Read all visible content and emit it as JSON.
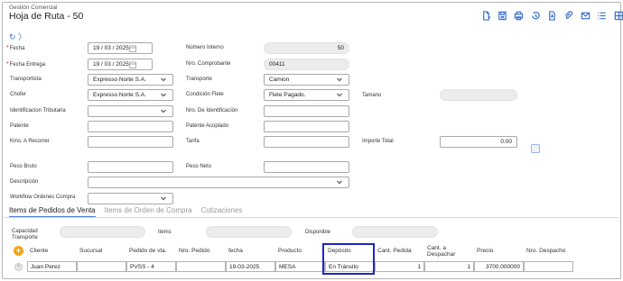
{
  "header": {
    "module": "Gestión Comercial",
    "title": "Hoja de Ruta - 50"
  },
  "toolbar": [
    {
      "icon": "new-document-icon"
    },
    {
      "icon": "save-icon"
    },
    {
      "icon": "print-icon"
    },
    {
      "icon": "history-icon"
    },
    {
      "icon": "pdf-icon"
    },
    {
      "icon": "attach-icon"
    },
    {
      "icon": "email-icon"
    },
    {
      "icon": "list-icon"
    },
    {
      "icon": "grid-icon"
    }
  ],
  "refresh": "↻ 〉",
  "form": {
    "fecha": {
      "label": "Fecha",
      "value": "19 / 03 / 2025"
    },
    "fecha_entrega": {
      "label": "Fecha Entrega",
      "value": "19 / 03 / 2025"
    },
    "transportista": {
      "label": "Transportista",
      "value": "Expresso Norte S.A."
    },
    "chofer": {
      "label": "Chofer",
      "value": "Expresso Norte S.A."
    },
    "identificacion": {
      "label": "Identificacion Tributaria",
      "value": ""
    },
    "patente": {
      "label": "Patente",
      "value": ""
    },
    "kms": {
      "label": "Kms. A Recorrer",
      "value": ""
    },
    "peso_bruto": {
      "label": "Peso Bruto",
      "value": ""
    },
    "descripcion": {
      "label": "Descripción",
      "value": ""
    },
    "workflow": {
      "label": "Workflow Ordenes Compra",
      "value": ""
    },
    "numero_interno": {
      "label": "Número Interno",
      "value": "50"
    },
    "nro_comprobante": {
      "label": "Nro. Comprobante",
      "value": "00411"
    },
    "transporte": {
      "label": "Transporte",
      "value": "Camion"
    },
    "condicion_flete": {
      "label": "Condición Flete",
      "value": "Flete Pagado."
    },
    "nro_identificacion": {
      "label": "Nro. De Identificación",
      "value": ""
    },
    "patente_acoplado": {
      "label": "Patente Acoplado",
      "value": ""
    },
    "tarifa": {
      "label": "Tarifa",
      "value": ""
    },
    "peso_neto": {
      "label": "Peso Neto",
      "value": ""
    },
    "tamano": {
      "label": "Tamano",
      "value": ""
    },
    "importe_total": {
      "label": "Importe Total",
      "value": "0.00"
    }
  },
  "tabs": [
    "Items de Pedidos de Venta",
    "Items de Orden de Compra",
    "Cotizaciones"
  ],
  "summary": {
    "capacidad": "Capacidad Transporte",
    "items": "Items",
    "disponible": "Disponible"
  },
  "table": {
    "headers": [
      "Cliente",
      "Sucursal",
      "Pedido de vta.",
      "Nro. Pedido",
      "fecha",
      "Producto",
      "Depósito",
      "Cant. Pedida",
      "Cant. a Despachar",
      "Precio",
      "Nro. Despacho"
    ],
    "rows": [
      [
        "Juan Perez",
        "",
        "PVSS - 4",
        "",
        "19-03-2025",
        "MESA",
        "En Tránsito",
        "1",
        "1",
        "3700.000000",
        ""
      ]
    ]
  },
  "colors": {
    "accent": "#3a6fcf",
    "highlight_box": "#1d24c9",
    "add_button": "#f2a51a"
  }
}
